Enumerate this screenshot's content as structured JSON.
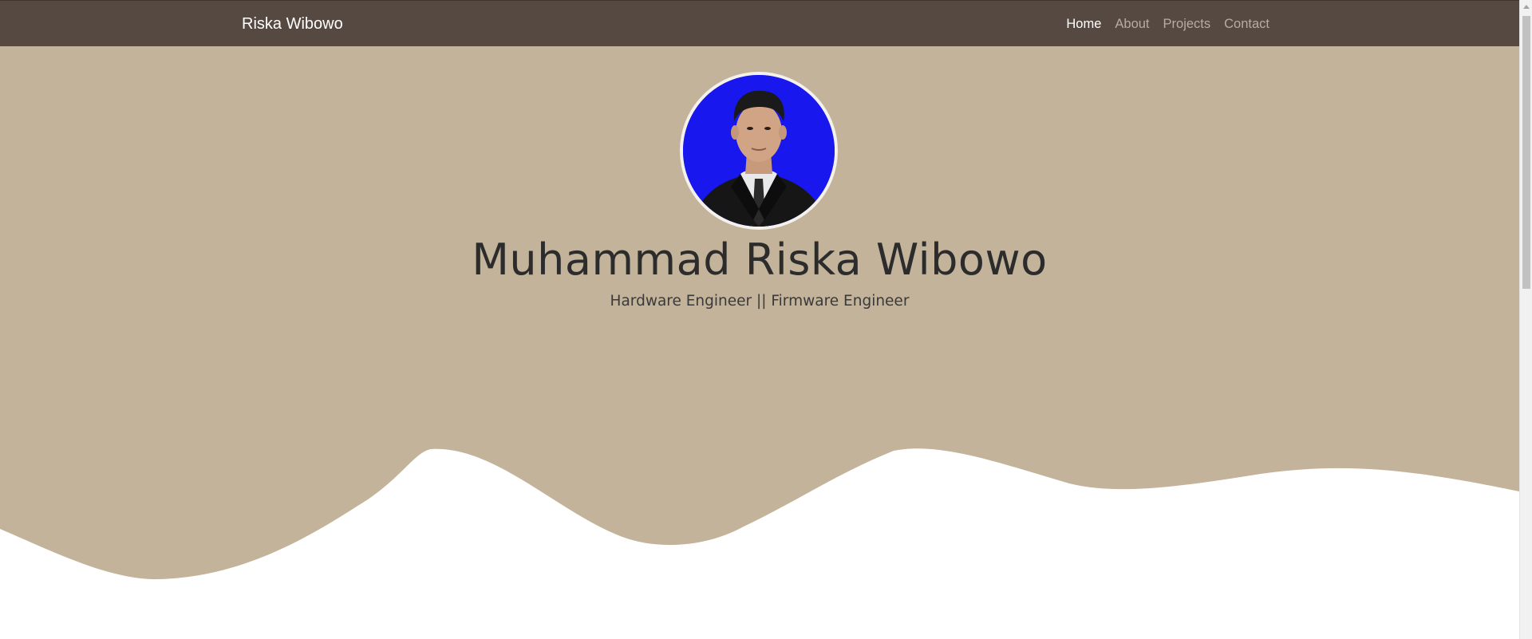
{
  "navbar": {
    "brand": "Riska Wibowo",
    "links": [
      {
        "label": "Home",
        "active": true
      },
      {
        "label": "About",
        "active": false
      },
      {
        "label": "Projects",
        "active": false
      },
      {
        "label": "Contact",
        "active": false
      }
    ]
  },
  "hero": {
    "name": "Muhammad Riska Wibowo",
    "subtitle": "Hardware Engineer || Firmware Engineer",
    "avatar_icon": "profile-photo"
  },
  "colors": {
    "navbar_bg": "#564941",
    "hero_bg": "#c2b39a",
    "page_bg": "#ffffff",
    "avatar_bg": "#1717ee"
  }
}
